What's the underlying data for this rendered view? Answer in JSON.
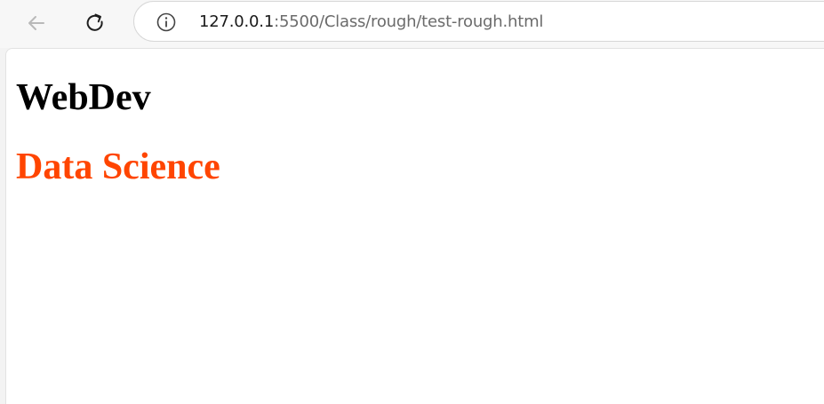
{
  "browser": {
    "url_host": "127.0.0.1",
    "url_path": ":5500/Class/rough/test-rough.html"
  },
  "page": {
    "heading1": "WebDev",
    "heading2": "Data Science"
  },
  "colors": {
    "heading2": "#ff4500"
  },
  "icons": {
    "back": "back-arrow-icon",
    "reload": "reload-icon",
    "info": "info-icon"
  }
}
